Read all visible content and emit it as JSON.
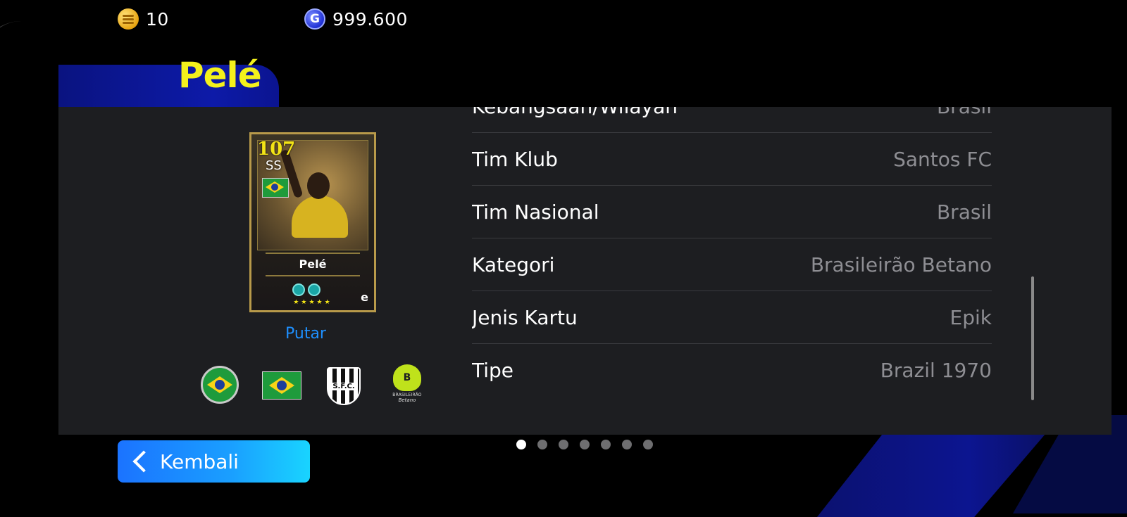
{
  "currency": {
    "coins": "10",
    "gp": "999.600",
    "gp_icon_letter": "G"
  },
  "player": {
    "name": "Pelé"
  },
  "card": {
    "rating": "107",
    "position": "SS",
    "name": "Pelé",
    "stars": "★★★★★",
    "logo": "e"
  },
  "flip_label": "Putar",
  "badges": {
    "club_text": "S.F.C.",
    "league_line1": "BRASILEIRÃO",
    "league_line2": "Betano"
  },
  "info_rows": [
    {
      "key": "Kebangsaan/Wilayah",
      "value": "Brasil"
    },
    {
      "key": "Tim Klub",
      "value": "Santos FC"
    },
    {
      "key": "Tim Nasional",
      "value": "Brasil"
    },
    {
      "key": "Kategori",
      "value": "Brasileirão Betano"
    },
    {
      "key": "Jenis Kartu",
      "value": "Epik"
    },
    {
      "key": "Tipe",
      "value": "Brazil 1970"
    }
  ],
  "pagination": {
    "total": 7,
    "active": 1
  },
  "back_label": "Kembali",
  "colors": {
    "accent_yellow": "#f4f11c",
    "link_blue": "#1e90ff",
    "panel_bg": "#1d1e21"
  }
}
